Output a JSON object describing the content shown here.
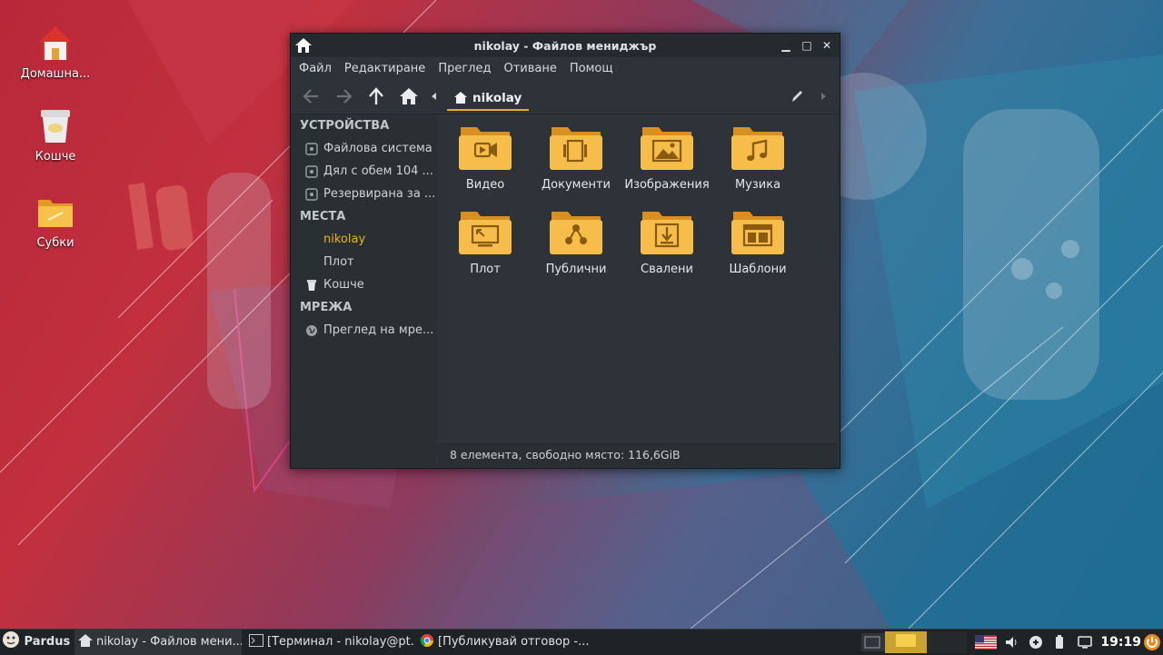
{
  "desktop": {
    "icons": [
      {
        "label": "Домашна...",
        "icon": "home-folder-icon"
      },
      {
        "label": "Кошче",
        "icon": "trash-icon"
      },
      {
        "label": "Субки",
        "icon": "folder-icon"
      }
    ]
  },
  "window": {
    "title": "nikolay - Файлов мениджър",
    "buttons": {
      "minimize": "▁",
      "maximize": "□",
      "close": "✕"
    },
    "menu": [
      "Файл",
      "Редактиране",
      "Преглед",
      "Отиване",
      "Помощ"
    ],
    "breadcrumb": "nikolay",
    "sidebar": {
      "sections": [
        {
          "heading": "УСТРОЙСТВА",
          "items": [
            {
              "label": "Файлова система",
              "icon": "drive-icon"
            },
            {
              "label": "Дял с обем 104 ...",
              "icon": "drive-icon"
            },
            {
              "label": "Резервирана за ...",
              "icon": "drive-icon"
            }
          ]
        },
        {
          "heading": "МЕСТА",
          "items": [
            {
              "label": "nikolay",
              "icon": "none",
              "active": true
            },
            {
              "label": "Плот",
              "icon": "none"
            },
            {
              "label": "Кошче",
              "icon": "trash-icon"
            }
          ]
        },
        {
          "heading": "МРЕЖА",
          "items": [
            {
              "label": "Преглед на мре...",
              "icon": "globe-icon"
            }
          ]
        }
      ]
    },
    "folders": [
      {
        "label": "Видео",
        "icon": "video-folder-icon"
      },
      {
        "label": "Документи",
        "icon": "documents-folder-icon"
      },
      {
        "label": "Изображения",
        "icon": "pictures-folder-icon"
      },
      {
        "label": "Музика",
        "icon": "music-folder-icon"
      },
      {
        "label": "Плот",
        "icon": "desktop-folder-icon"
      },
      {
        "label": "Публични",
        "icon": "public-folder-icon"
      },
      {
        "label": "Свалени",
        "icon": "downloads-folder-icon"
      },
      {
        "label": "Шаблони",
        "icon": "templates-folder-icon"
      }
    ],
    "status": "8 елемента, свободно място: 116,6GiB"
  },
  "taskbar": {
    "start_label": "Pardus",
    "tasks": [
      {
        "label": "nikolay - Файлов мени...",
        "icon": "home-icon",
        "active": true
      },
      {
        "label": "[Терминал - nikolay@pt...",
        "icon": "terminal-icon"
      },
      {
        "label": "[Публикувай отговор -...",
        "icon": "chrome-icon"
      }
    ],
    "clock": "19:19"
  },
  "colors": {
    "accent": "#e3b21a",
    "folder": "#f2b843",
    "window_bg": "#2d3338"
  }
}
